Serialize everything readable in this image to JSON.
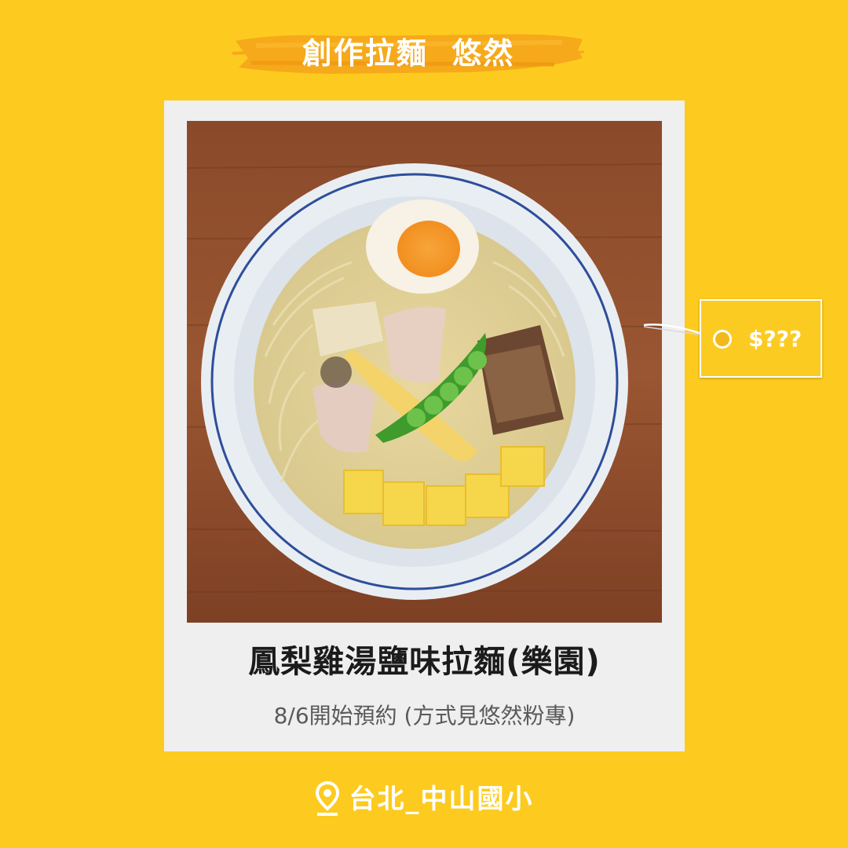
{
  "header": {
    "shop_name": "創作拉麵  悠然"
  },
  "card": {
    "dish_name": "鳳梨雞湯鹽味拉麵(樂園)",
    "reservation_note": "8/6開始預約 (方式見悠然粉專)"
  },
  "price_tag": {
    "label": "$???"
  },
  "footer": {
    "location": "台北_中山國小",
    "icon": "location-pin-icon"
  },
  "colors": {
    "background": "#FDCB1F",
    "banner_stroke": "#F6A91A",
    "card": "#EFEFEF",
    "text_dark": "#1b1b1b",
    "text_muted": "#5a5a5a",
    "text_light": "#ffffff"
  }
}
